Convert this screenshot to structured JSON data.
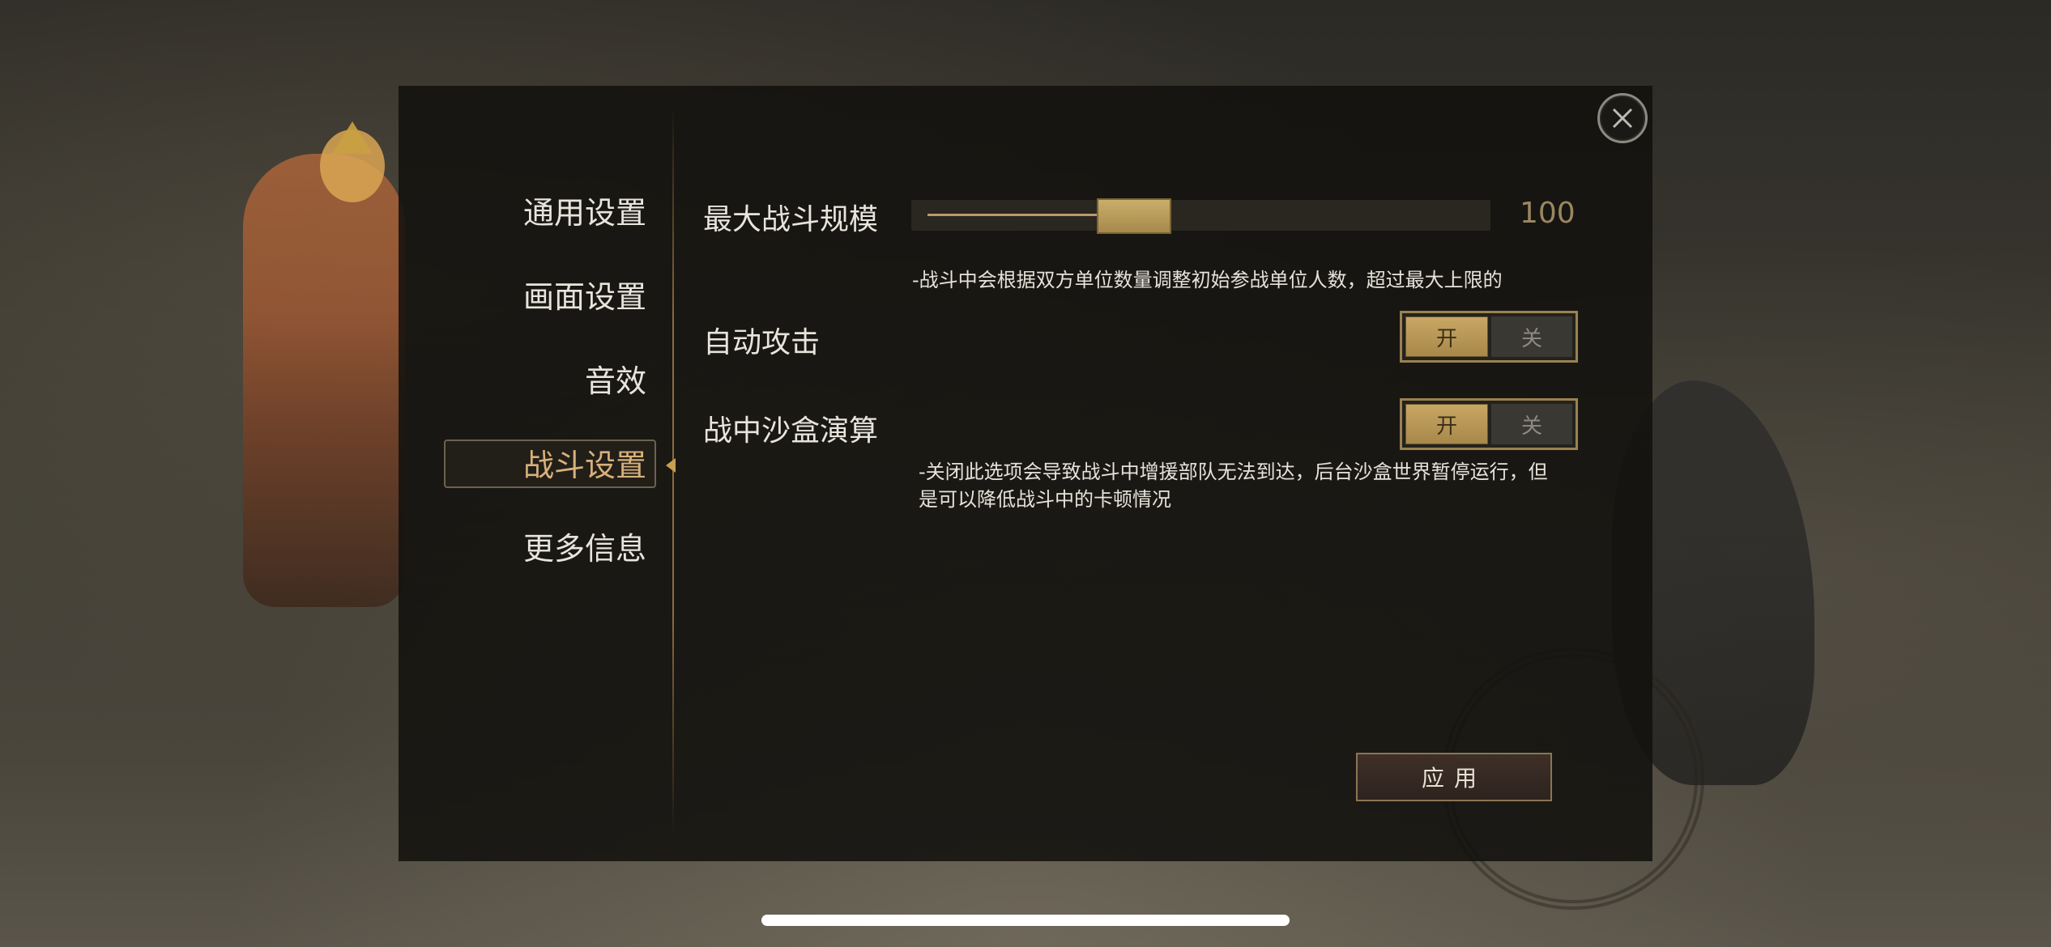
{
  "nav": {
    "items": [
      {
        "label": "通用设置"
      },
      {
        "label": "画面设置"
      },
      {
        "label": "音效"
      },
      {
        "label": "战斗设置"
      },
      {
        "label": "更多信息"
      }
    ],
    "active_index": 3
  },
  "settings": {
    "max_battle_scale": {
      "label": "最大战斗规模",
      "value": "100",
      "fill_fraction": 0.32,
      "description": "-战斗中会根据双方单位数量调整初始参战单位人数，超过最大上限的"
    },
    "auto_attack": {
      "label": "自动攻击",
      "on_label": "开",
      "off_label": "关",
      "state": "on"
    },
    "sandbox_sim": {
      "label": "战中沙盒演算",
      "on_label": "开",
      "off_label": "关",
      "state": "on",
      "description": "-关闭此选项会导致战斗中增援部队无法到达，后台沙盒世界暂停运行，但是可以降低战斗中的卡顿情况"
    }
  },
  "apply_button": {
    "label": "应用"
  },
  "icons": {
    "close": "close-icon"
  },
  "colors": {
    "accent_gold": "#c8a764",
    "active_nav_text": "#d8b07a",
    "panel_bg": "#12110e"
  }
}
